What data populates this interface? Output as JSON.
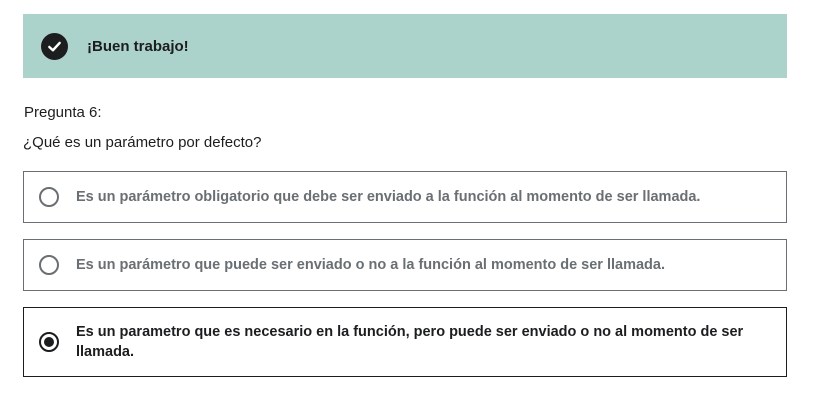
{
  "banner": {
    "title": "¡Buen trabajo!",
    "icon": "check-icon",
    "background": "#acd2cc"
  },
  "question": {
    "number_label": "Pregunta 6:",
    "text": "¿Qué es un parámetro por defecto?"
  },
  "options": [
    {
      "label": "Es un parámetro obligatorio que debe ser enviado a la función al momento de ser llamada.",
      "selected": false
    },
    {
      "label": "Es un parámetro que puede ser enviado o no a la función al momento de ser llamada.",
      "selected": false
    },
    {
      "label": "Es un parametro que es necesario en la función, pero puede ser enviado o no al momento de ser llamada.",
      "selected": true
    }
  ]
}
